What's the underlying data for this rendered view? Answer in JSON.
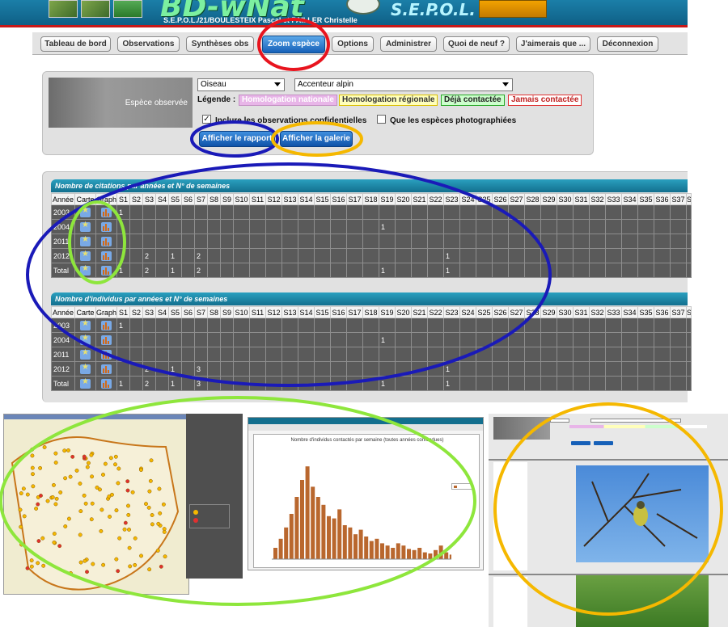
{
  "header": {
    "logo_text": "BD-wNat",
    "subtitle": "S.E.P.O.L./21/BOULESTEIX Pascal et PAILLER Christelle",
    "brand": "S.E.P.O.L."
  },
  "tabs": [
    {
      "label": "Tableau de bord"
    },
    {
      "label": "Observations"
    },
    {
      "label": "Synthèses obs"
    },
    {
      "label": "Zoom espèce",
      "active": true
    },
    {
      "label": "Options"
    },
    {
      "label": "Administrer"
    },
    {
      "label": "Quoi de neuf ?"
    },
    {
      "label": "J'aimerais que ..."
    },
    {
      "label": "Déconnexion"
    }
  ],
  "panel": {
    "species_label": "Espèce observée",
    "group_value": "Oiseau",
    "species_value": "Accenteur alpin",
    "legend_label": "Légende :",
    "legend": [
      {
        "label": "Homologation nationale",
        "color": "#e8b5e8"
      },
      {
        "label": "Homologation régionale",
        "color": "#ffffbb"
      },
      {
        "label": "Déjà contactée",
        "color": "#ccffcc"
      },
      {
        "label": "Jamais contactée",
        "color": "#ffffff"
      }
    ],
    "include_confidential_label": "Inclure les observations confidentielles",
    "include_confidential_checked": true,
    "photographed_only_label": "Que les espèces photographiées",
    "photographed_only_checked": false,
    "show_report_button": "Afficher le rapport",
    "show_gallery_button": "Afficher la galerie"
  },
  "tables": {
    "columns": [
      "Année",
      "Carte",
      "Graph",
      "S1",
      "S2",
      "S3",
      "S4",
      "S5",
      "S6",
      "S7",
      "S8",
      "S9",
      "S10",
      "S11",
      "S12",
      "S13",
      "S14",
      "S15",
      "S16",
      "S17",
      "S18",
      "S19",
      "S20",
      "S21",
      "S22",
      "S23",
      "S24",
      "S25",
      "S26",
      "S27",
      "S28",
      "S29",
      "S30",
      "S31",
      "S32",
      "S33",
      "S34",
      "S35",
      "S36",
      "S37",
      "S"
    ],
    "citations": {
      "title": "Nombre de citations par années et N° de semaines",
      "rows": [
        {
          "year": "2003",
          "cells": {
            "S1": "1"
          }
        },
        {
          "year": "2004",
          "cells": {
            "S19": "1"
          }
        },
        {
          "year": "2011",
          "cells": {}
        },
        {
          "year": "2012",
          "cells": {
            "S3": "2",
            "S5": "1",
            "S7": "2",
            "S23": "1"
          }
        },
        {
          "year": "Total",
          "cells": {
            "S1": "1",
            "S3": "2",
            "S5": "1",
            "S7": "2",
            "S19": "1",
            "S23": "1"
          }
        }
      ]
    },
    "individuals": {
      "title": "Nombre d'individus par années et N° de semaines",
      "rows": [
        {
          "year": "2003",
          "cells": {
            "S1": "1"
          }
        },
        {
          "year": "2004",
          "cells": {
            "S19": "1"
          }
        },
        {
          "year": "2011",
          "cells": {}
        },
        {
          "year": "2012",
          "cells": {
            "S3": "2",
            "S5": "1",
            "S7": "3",
            "S23": "1"
          }
        },
        {
          "year": "Total",
          "cells": {
            "S1": "1",
            "S3": "2",
            "S5": "1",
            "S7": "3",
            "S19": "1",
            "S23": "1"
          }
        }
      ]
    }
  },
  "chart_shot": {
    "title": "Nombre d'individus contactés par semaine (toutes années confondues)"
  },
  "colors": {
    "header_blue": "#136f8e",
    "active_tab": "#1660b8",
    "highlight_red": "#e8141e",
    "highlight_blue": "#1a1ab8",
    "highlight_yellow": "#f5b800",
    "highlight_green": "#8ee63c"
  }
}
